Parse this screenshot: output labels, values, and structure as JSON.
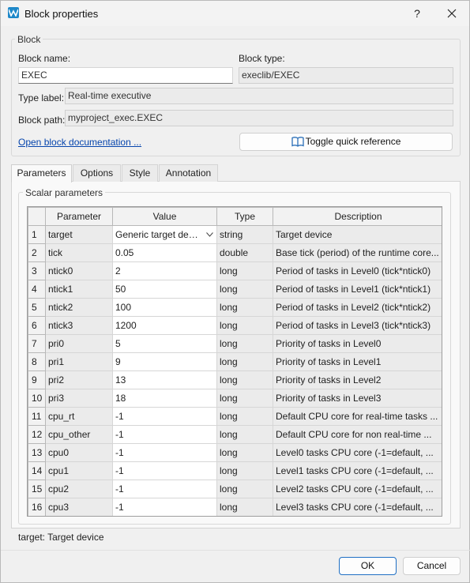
{
  "window": {
    "title": "Block properties",
    "help_glyph": "?",
    "icons": {
      "app": "app-logo-icon",
      "close": "close-icon"
    }
  },
  "block_group": {
    "title": "Block",
    "name_label": "Block name:",
    "name_value": "EXEC",
    "type_label": "Block type:",
    "type_value": "execlib/EXEC",
    "typelabel_label": "Type label:",
    "typelabel_value": "Real-time executive",
    "path_label": "Block path:",
    "path_value": "myproject_exec.EXEC",
    "doc_link": "Open block documentation ...",
    "quick_ref_button": "Toggle quick reference"
  },
  "tabs": [
    {
      "label": "Parameters",
      "active": true
    },
    {
      "label": "Options",
      "active": false
    },
    {
      "label": "Style",
      "active": false
    },
    {
      "label": "Annotation",
      "active": false
    }
  ],
  "scalar_group": {
    "title": "Scalar parameters"
  },
  "table": {
    "columns": [
      "Parameter",
      "Value",
      "Type",
      "Description"
    ],
    "rows": [
      {
        "num": "1",
        "param": "target",
        "value": "Generic target device",
        "type": "string",
        "desc": "Target device"
      },
      {
        "num": "2",
        "param": "tick",
        "value": "0.05",
        "type": "double",
        "desc": "Base tick (period) of the runtime core..."
      },
      {
        "num": "3",
        "param": "ntick0",
        "value": "2",
        "type": "long",
        "desc": "Period of tasks in Level0 (tick*ntick0)"
      },
      {
        "num": "4",
        "param": "ntick1",
        "value": "50",
        "type": "long",
        "desc": "Period of tasks in Level1 (tick*ntick1)"
      },
      {
        "num": "5",
        "param": "ntick2",
        "value": "100",
        "type": "long",
        "desc": "Period of tasks in Level2 (tick*ntick2)"
      },
      {
        "num": "6",
        "param": "ntick3",
        "value": "1200",
        "type": "long",
        "desc": "Period of tasks in Level3 (tick*ntick3)"
      },
      {
        "num": "7",
        "param": "pri0",
        "value": "5",
        "type": "long",
        "desc": "Priority of tasks in Level0"
      },
      {
        "num": "8",
        "param": "pri1",
        "value": "9",
        "type": "long",
        "desc": "Priority of tasks in Level1"
      },
      {
        "num": "9",
        "param": "pri2",
        "value": "13",
        "type": "long",
        "desc": "Priority of tasks in Level2"
      },
      {
        "num": "10",
        "param": "pri3",
        "value": "18",
        "type": "long",
        "desc": "Priority of tasks in Level3"
      },
      {
        "num": "11",
        "param": "cpu_rt",
        "value": "-1",
        "type": "long",
        "desc": "Default CPU core for real-time tasks ..."
      },
      {
        "num": "12",
        "param": "cpu_other",
        "value": "-1",
        "type": "long",
        "desc": "Default CPU core for non real-time ..."
      },
      {
        "num": "13",
        "param": "cpu0",
        "value": "-1",
        "type": "long",
        "desc": "Level0 tasks CPU core (-1=default, ..."
      },
      {
        "num": "14",
        "param": "cpu1",
        "value": "-1",
        "type": "long",
        "desc": "Level1 tasks CPU core (-1=default, ..."
      },
      {
        "num": "15",
        "param": "cpu2",
        "value": "-1",
        "type": "long",
        "desc": "Level2 tasks CPU core (-1=default, ..."
      },
      {
        "num": "16",
        "param": "cpu3",
        "value": "-1",
        "type": "long",
        "desc": "Level3 tasks CPU core (-1=default, ..."
      }
    ]
  },
  "status_text": "target: Target device",
  "footer": {
    "ok": "OK",
    "cancel": "Cancel"
  },
  "colors": {
    "accent": "#1f6fc4",
    "link": "#0645ad",
    "app_icon": "#1e88c9"
  }
}
